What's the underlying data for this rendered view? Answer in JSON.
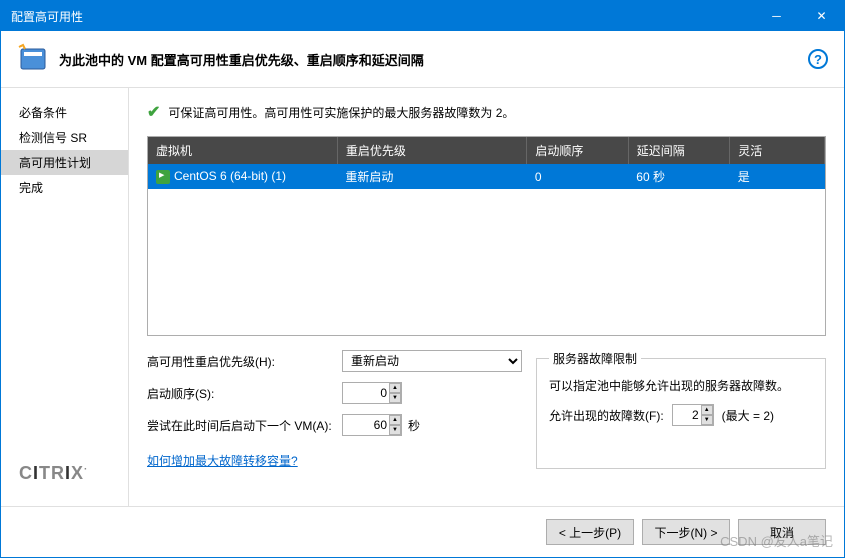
{
  "titlebar": {
    "title": "配置高可用性"
  },
  "header": {
    "text": "为此池中的 VM 配置高可用性重启优先级、重启顺序和延迟间隔"
  },
  "sidebar": {
    "items": [
      {
        "label": "必备条件"
      },
      {
        "label": "检测信号 SR"
      },
      {
        "label": "高可用性计划"
      },
      {
        "label": "完成"
      }
    ]
  },
  "status": {
    "text": "可保证高可用性。高可用性可实施保护的最大服务器故障数为 2。"
  },
  "table": {
    "headers": {
      "vm": "虚拟机",
      "priority": "重启优先级",
      "order": "启动顺序",
      "delay": "延迟间隔",
      "agile": "灵活"
    },
    "rows": [
      {
        "vm": "CentOS 6 (64-bit) (1)",
        "priority": "重新启动",
        "order": "0",
        "delay": "60 秒",
        "agile": "是"
      }
    ]
  },
  "form": {
    "priority_label": "高可用性重启优先级(H):",
    "priority_value": "重新启动",
    "order_label": "启动顺序(S):",
    "order_value": "0",
    "delay_label": "尝试在此时间后启动下一个 VM(A):",
    "delay_value": "60",
    "delay_unit": "秒"
  },
  "fieldset": {
    "legend": "服务器故障限制",
    "desc": "可以指定池中能够允许出现的服务器故障数。",
    "fail_label": "允许出现的故障数(F):",
    "fail_value": "2",
    "fail_max": "(最大 = 2)"
  },
  "link": {
    "text": "如何增加最大故障转移容量?"
  },
  "footer": {
    "prev": "< 上一步(P)",
    "next": "下一步(N) >",
    "cancel": "取消"
  },
  "watermark": "CSDN @友人a笔记",
  "logo": "CITRIX"
}
